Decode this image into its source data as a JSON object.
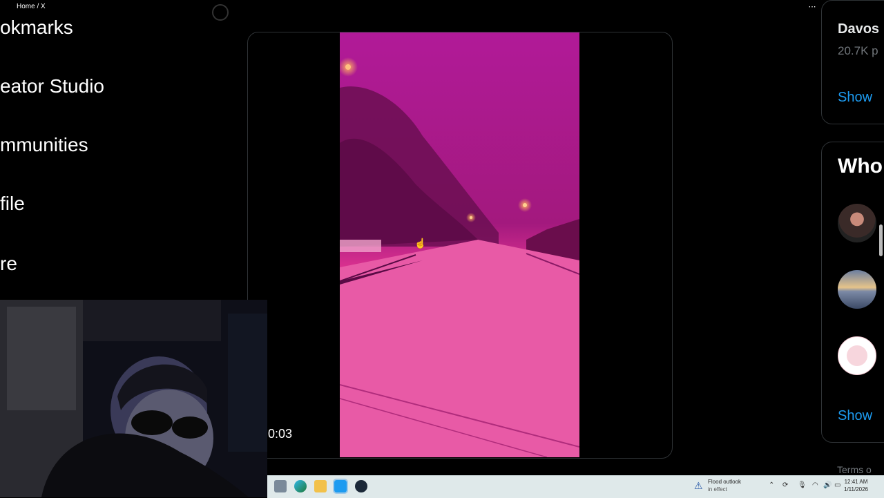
{
  "window": {
    "title": "Home / X"
  },
  "left_nav": {
    "items": [
      {
        "label": "okmarks"
      },
      {
        "label": "eator Studio"
      },
      {
        "label": "mmunities"
      },
      {
        "label": "file"
      },
      {
        "label": "re"
      }
    ]
  },
  "tweet": {
    "video_duration": "0:03"
  },
  "right_sidebar": {
    "trend_title": "Davos",
    "trend_count": "20.7K p",
    "show_more_1": "Show",
    "who_to_follow_heading": "Who",
    "show_more_2": "Show",
    "footer_link": "Terms o"
  },
  "taskbar": {
    "weather_line1": "Flood outlook",
    "weather_line2": "in effect",
    "time": "12:41 AM",
    "date": "1/11/2026"
  }
}
